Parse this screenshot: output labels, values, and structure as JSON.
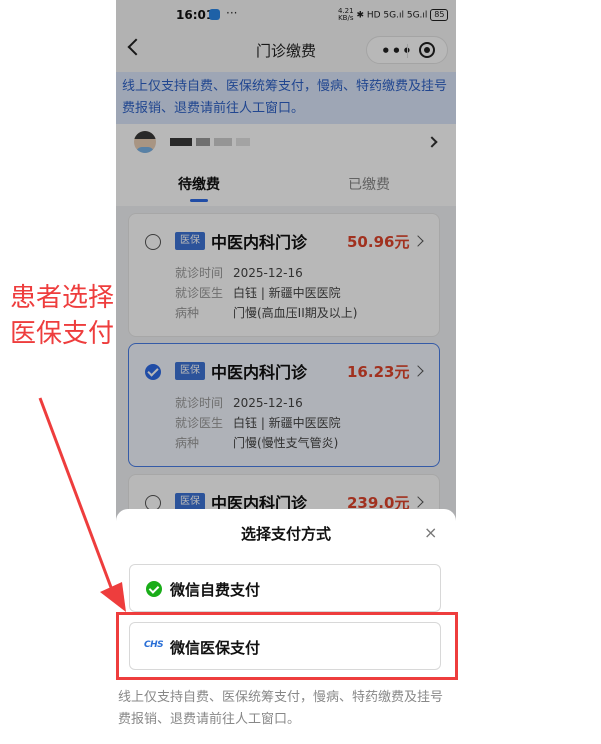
{
  "status_bar": {
    "time": "16:01",
    "dots": "···",
    "speed_top": "4.21",
    "speed_bottom": "KB/s",
    "signals": "✱ HD 5G.ıl 5G.ıl",
    "battery": "85"
  },
  "nav": {
    "title": "门诊缴费",
    "more": "•••"
  },
  "notice": "线上仅支持自费、医保统筹支付，慢病、特药缴费及挂号费报销、退费请前往人工窗口。",
  "tabs": {
    "pending": "待缴费",
    "paid": "已缴费"
  },
  "record_labels": {
    "visit_time": "就诊时间",
    "doctor": "就诊医生",
    "disease": "病种"
  },
  "records": [
    {
      "tag": "医保",
      "department": "中医内科门诊",
      "amount": "50.96元",
      "visit_time": "2025-12-16",
      "doctor": "白钰 | 新疆中医医院",
      "disease": "门慢(高血压II期及以上)",
      "selected": false
    },
    {
      "tag": "医保",
      "department": "中医内科门诊",
      "amount": "16.23元",
      "visit_time": "2025-12-16",
      "doctor": "白钰 | 新疆中医医院",
      "disease": "门慢(慢性支气管炎)",
      "selected": true
    },
    {
      "tag": "医保",
      "department": "中医内科门诊",
      "amount": "239.0元",
      "selected": false
    }
  ],
  "sheet": {
    "title": "选择支付方式",
    "close": "×",
    "options": [
      {
        "label": "微信自费支付",
        "icon": "wechat-pay-icon"
      },
      {
        "label": "微信医保支付",
        "icon": "chs-icon",
        "icon_text": "CHS"
      }
    ],
    "notice": "线上仅支持自费、医保统筹支付，慢病、特药缴费及挂号费报销、退费请前往人工窗口。"
  },
  "annotation": {
    "text": "患者选择医保支付",
    "color": "#ee3d3d"
  },
  "colors": {
    "accent": "#2e6be6",
    "amount": "#e0452b",
    "notice_bg": "#dbe7fb",
    "wechat": "#1aad19"
  }
}
